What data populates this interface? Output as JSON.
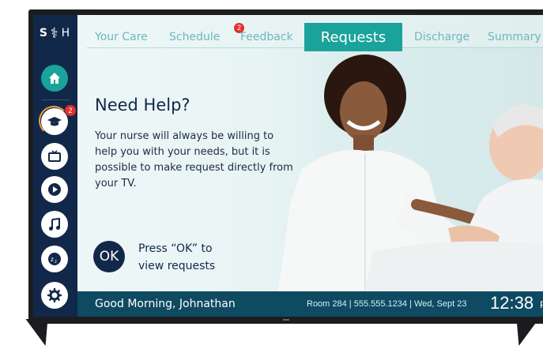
{
  "brand": {
    "s": "S",
    "h": "H"
  },
  "nav": {
    "tabs": [
      {
        "label": "Your Care"
      },
      {
        "label": "Schedule"
      },
      {
        "label": "Feedback",
        "badge": "2"
      },
      {
        "label": "Requests",
        "active": true
      },
      {
        "label": "Discharge"
      },
      {
        "label": "Summary"
      }
    ]
  },
  "sidebar": {
    "items": [
      {
        "icon": "home-icon",
        "active": true
      },
      {
        "icon": "education-icon",
        "badge": "2"
      },
      {
        "icon": "tv-icon"
      },
      {
        "icon": "play-icon"
      },
      {
        "icon": "music-icon"
      },
      {
        "icon": "sleep-icon"
      },
      {
        "icon": "settings-icon"
      }
    ]
  },
  "main": {
    "headline": "Need Help?",
    "body": "Your nurse will always be willing to help you with your needs, but it is possible to make request directly from your TV.",
    "ok_button": "OK",
    "ok_label": "Press “OK” to view requests"
  },
  "footer": {
    "greeting": "Good Morning, Johnathan",
    "room_info": "Room 284  |  555.555.1234  |  Wed, Sept 23",
    "time": "12:38",
    "ampm": "PM"
  },
  "colors": {
    "sidebar": "#12284a",
    "accent": "#1aa39a",
    "footer": "#0f4a63",
    "badge": "#e0322f"
  }
}
